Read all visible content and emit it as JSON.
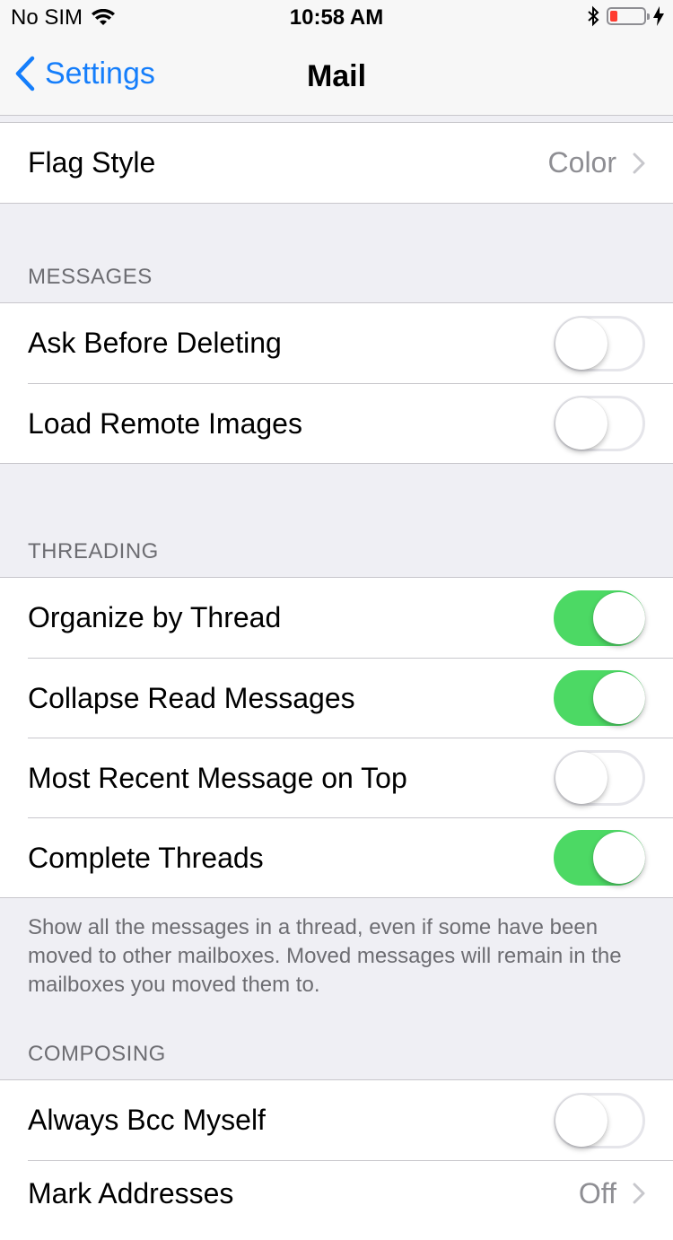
{
  "status_bar": {
    "carrier": "No SIM",
    "time": "10:58 AM"
  },
  "nav": {
    "back_label": "Settings",
    "title": "Mail"
  },
  "flag_style": {
    "label": "Flag Style",
    "value": "Color"
  },
  "messages": {
    "header": "MESSAGES",
    "rows": [
      {
        "label": "Ask Before Deleting",
        "on": false
      },
      {
        "label": "Load Remote Images",
        "on": false
      }
    ]
  },
  "threading": {
    "header": "THREADING",
    "rows": [
      {
        "label": "Organize by Thread",
        "on": true
      },
      {
        "label": "Collapse Read Messages",
        "on": true
      },
      {
        "label": "Most Recent Message on Top",
        "on": false
      },
      {
        "label": "Complete Threads",
        "on": true
      }
    ],
    "footer": "Show all the messages in a thread, even if some have been moved to other mailboxes. Moved messages will remain in the mailboxes you moved them to."
  },
  "composing": {
    "header": "COMPOSING",
    "rows": [
      {
        "label": "Always Bcc Myself",
        "on": false
      }
    ],
    "mark_addresses": {
      "label": "Mark Addresses",
      "value": "Off"
    }
  },
  "colors": {
    "accent": "#157efb",
    "toggle_on": "#4cd964",
    "battery_low": "#ff3b30"
  }
}
